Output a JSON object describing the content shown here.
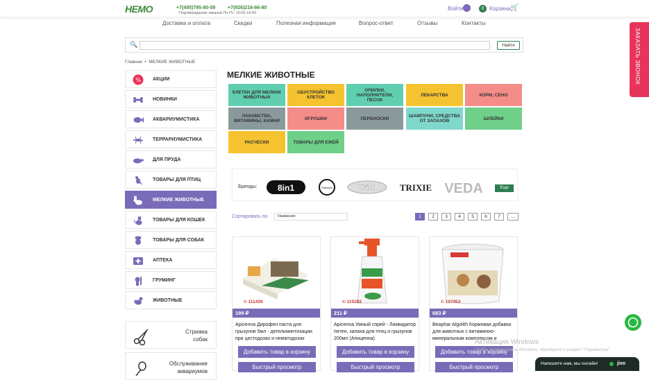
{
  "header": {
    "logo": "НЕМО",
    "phone1": "+7(495)795-80-09",
    "phone2": "+7(926)216-66-80",
    "phone_hint": "Подтверждение заказов Пн-Пт: 10:00-19:00",
    "login": "Войти",
    "cart_count": "0",
    "cart_label": "Корзина"
  },
  "nav": [
    "Доставка и оплата",
    "Скидки",
    "Полезная информация",
    "Вопрос-ответ",
    "Отзывы",
    "Контакты"
  ],
  "search": {
    "placeholder": "",
    "button": "Найти"
  },
  "callback": "ЗАКАЗАТЬ ЗВОНОК",
  "breadcrumb": {
    "home": "Главная",
    "sep": "•",
    "current": "МЕЛКИЕ ЖИВОТНЫЕ"
  },
  "sidebar": {
    "items": [
      {
        "label": "АКЦИИ",
        "icon": "percent-icon"
      },
      {
        "label": "НОВИНКИ",
        "icon": "bone-icon"
      },
      {
        "label": "АКВАРИУМИСТИКА",
        "icon": "fish-icon"
      },
      {
        "label": "ТЕРРАРИУМИСТИКА",
        "icon": "lizard-icon"
      },
      {
        "label": "ДЛЯ ПРУДА",
        "icon": "turtle-icon"
      },
      {
        "label": "ТОВАРЫ ДЛЯ ПТИЦ",
        "icon": "bird-icon"
      },
      {
        "label": "МЕЛКИЕ ЖИВОТНЫЕ",
        "icon": "rabbit-icon"
      },
      {
        "label": "ТОВАРЫ ДЛЯ КОШЕК",
        "icon": "cat-icon"
      },
      {
        "label": "ТОВАРЫ ДЛЯ СОБАК",
        "icon": "dog-icon"
      },
      {
        "label": "АПТЕКА",
        "icon": "first-aid-icon"
      },
      {
        "label": "ГРУМИНГ",
        "icon": "grooming-icon"
      },
      {
        "label": "ЖИВОТНЫЕ",
        "icon": "animals-icon"
      }
    ],
    "services": [
      {
        "line1": "Стрижка",
        "line2": "собак"
      },
      {
        "line1": "Обслуживание",
        "line2": "аквариумов"
      }
    ]
  },
  "page_title": "МЕЛКИЕ ЖИВОТНЫЕ",
  "categories": [
    {
      "label": "КЛЕТКИ ДЛЯ МЕЛКИХ ЖИВОТНЫХ",
      "color": "#5fcfb0"
    },
    {
      "label": "ОБУСТРОЙСТВО КЛЕТОК",
      "color": "#f5c330"
    },
    {
      "label": "ОПИЛКИ, НАПОЛНИТЕЛИ, ПЕСОК",
      "color": "#5fcfb0"
    },
    {
      "label": "ЛЕКАРСТВА",
      "color": "#f5c330"
    },
    {
      "label": "КОРМ, СЕНО",
      "color": "#f48c88"
    },
    {
      "label": "ЛАКОМСТВА, ВИТАМИНЫ, КАМНИ",
      "color": "#8a9a9c"
    },
    {
      "label": "ИГРУШКИ",
      "color": "#f48c88"
    },
    {
      "label": "ПЕРЕНОСКИ",
      "color": "#8a9a9c"
    },
    {
      "label": "ШАМПУНИ, СРЕДСТВА ОТ ЗАПАХОВ",
      "color": "#7fd8cc"
    },
    {
      "label": "ШЛЕЙКИ",
      "color": "#6fd08a"
    },
    {
      "label": "РАСЧЕСКИ",
      "color": "#f5c330"
    },
    {
      "label": "ТОВАРЫ ДЛЯ ЕЖЕЙ",
      "color": "#6fd08a"
    }
  ],
  "brands": {
    "label": "Бренды:",
    "names": [
      "8in1",
      "Padovan",
      "Triol",
      "TRIXIE",
      "VEDA"
    ],
    "more": "Еще"
  },
  "sort": {
    "label": "Сортировать по",
    "value": "Названию"
  },
  "pagination": [
    "1",
    "2",
    "3",
    "4",
    "5",
    "6",
    "7",
    "..."
  ],
  "products": [
    {
      "code": "© 111439",
      "price": "199 ₽",
      "title": "Apicenna Дирофен паста для грызунов 5мл - дегельминтизации при цестодозах и нематодозах"
    },
    {
      "code": "© 115283",
      "price": "211 ₽",
      "title": "Apicenna Умный спрей - Ликвидатор пятен, запаха для птиц и грызунов 200мл (Апиценна)"
    },
    {
      "code": "© 127453",
      "price": "683 ₽",
      "title": "Beaphar Algolith Кормовая добавка для животных с витаминно-минеральным комплексом и"
    }
  ],
  "product_buttons": {
    "add": "Добавить товар в корзину",
    "quick": "Быстрый просмотр"
  },
  "chat": {
    "text": "Напишите нам, мы онлайн!",
    "logo": "jivo"
  },
  "watermark": {
    "line1": "Активация Windows",
    "line2": "Чтобы активировать Windows, перейдите в раздел \"Параметры\"."
  }
}
